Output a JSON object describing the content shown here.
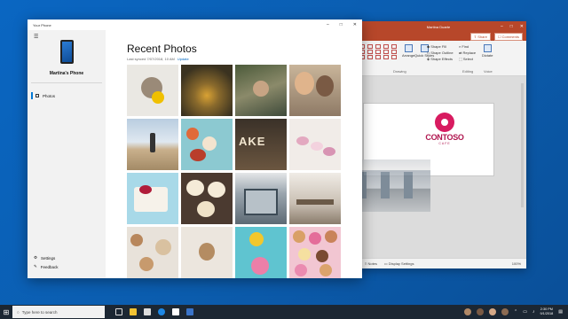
{
  "your_phone": {
    "window_title": "Your Phone",
    "phone_name": "Martina's Phone",
    "nav_photos": "Photos",
    "settings": "Settings",
    "feedback": "Feedback",
    "heading": "Recent Photos",
    "last_synced": "Last synced 7/07/2018, 10 AM",
    "update_link": "Update"
  },
  "powerpoint": {
    "title": "Martina Duarte",
    "share": "Share",
    "comments": "Comments",
    "arrange": "Arrange",
    "quick_styles": "Quick Styles",
    "shape_fill": "Shape Fill",
    "shape_outline": "Shape Outline",
    "shape_effects": "Shape Effects",
    "find": "Find",
    "replace": "Replace",
    "select": "Select",
    "dictate": "Dictate",
    "group_drawing": "Drawing",
    "group_editing": "Editing",
    "group_voice": "Voice",
    "logo_name": "CONTOSO",
    "logo_sub": "CAFE",
    "status_notes": "Notes",
    "status_display": "Display Settings",
    "zoom": "100%"
  },
  "taskbar": {
    "search_placeholder": "Type here to search",
    "time": "2:30 PM",
    "date": "9/1/2018"
  }
}
